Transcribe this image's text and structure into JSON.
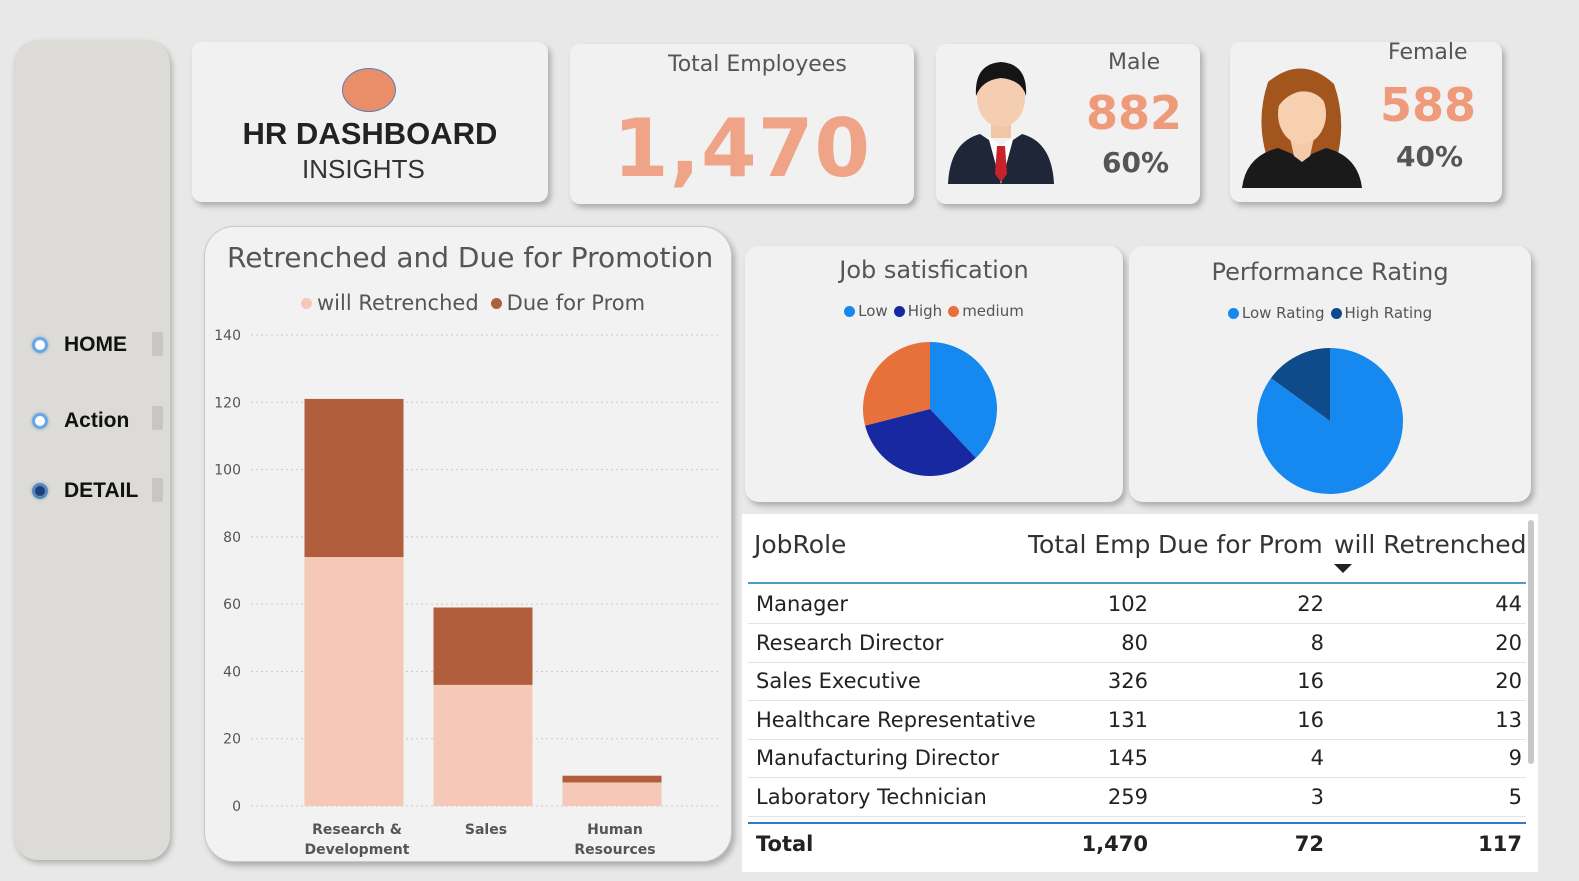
{
  "sidebar": {
    "items": [
      {
        "label": "HOME",
        "selected": false
      },
      {
        "label": "Action",
        "selected": false
      },
      {
        "label": "DETAIL",
        "selected": true
      }
    ]
  },
  "header": {
    "title": "HR DASHBOARD",
    "subtitle": "INSIGHTS"
  },
  "kpis": {
    "total": {
      "label": "Total Employees",
      "value": "1,470"
    },
    "male": {
      "label": "Male",
      "value": "882",
      "pct": "60%",
      "icon": "male-avatar-icon"
    },
    "female": {
      "label": "Female",
      "value": "588",
      "pct": "40%",
      "icon": "female-avatar-icon"
    }
  },
  "colors": {
    "accent": "#efa488",
    "retrenched": "#f5c8b7",
    "promotion": "#b05e3c",
    "low": "#1589f0",
    "high": "#1828a0",
    "medium": "#e8703a",
    "high_rating": "#0f4a8a"
  },
  "chart_data": [
    {
      "type": "bar",
      "stacked": true,
      "title": "Retrenched and Due for Promotion",
      "categories": [
        "Research & Development",
        "Sales",
        "Human Resources"
      ],
      "category_lines": [
        [
          "Research &",
          "Development"
        ],
        [
          "Sales"
        ],
        [
          "Human",
          "Resources"
        ]
      ],
      "series": [
        {
          "name": "will Retrenched",
          "values": [
            74,
            36,
            7
          ]
        },
        {
          "name": "Due for Prom",
          "values": [
            47,
            23,
            2
          ]
        }
      ],
      "ylim": [
        0,
        140
      ],
      "yticks": [
        0,
        20,
        40,
        60,
        80,
        100,
        120,
        140
      ],
      "legend": "top"
    },
    {
      "type": "pie",
      "title": "Job satisfication",
      "labels": [
        "Low",
        "High",
        "medium"
      ],
      "values": [
        38,
        33,
        29
      ],
      "legend": "top"
    },
    {
      "type": "pie",
      "title": "Performance Rating",
      "labels": [
        "Low Rating",
        "High Rating"
      ],
      "values": [
        85,
        15
      ],
      "legend": "top"
    },
    {
      "type": "table",
      "columns": [
        "JobRole",
        "Total Emp",
        "Due for Prom",
        "will Retrenched"
      ],
      "rows": [
        [
          "Manager",
          "102",
          "22",
          "44"
        ],
        [
          "Research Director",
          "80",
          "8",
          "20"
        ],
        [
          "Sales Executive",
          "326",
          "16",
          "20"
        ],
        [
          "Healthcare Representative",
          "131",
          "16",
          "13"
        ],
        [
          "Manufacturing Director",
          "145",
          "4",
          "9"
        ],
        [
          "Laboratory Technician",
          "259",
          "3",
          "5"
        ]
      ],
      "total": [
        "Total",
        "1,470",
        "72",
        "117"
      ],
      "sorted_by": "will Retrenched"
    }
  ]
}
